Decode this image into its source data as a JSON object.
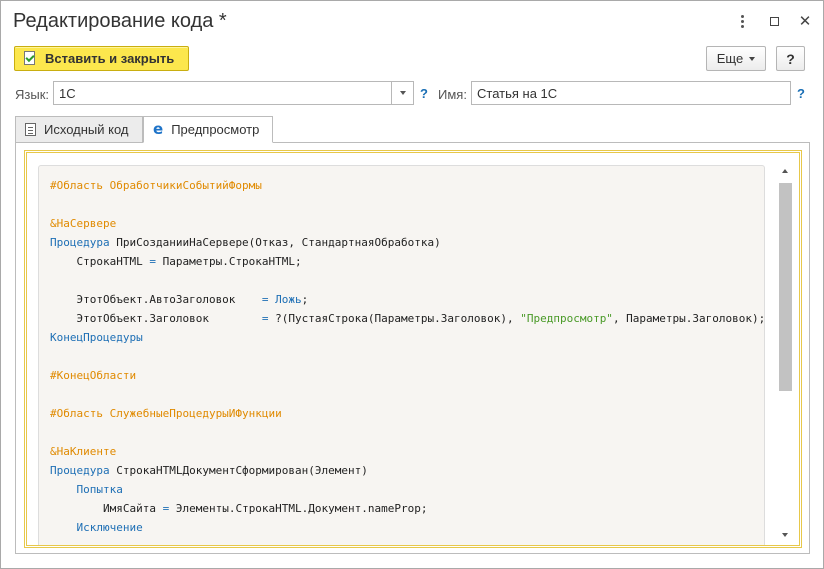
{
  "window": {
    "title": "Редактирование кода *"
  },
  "toolbar": {
    "insert_close_label": "Вставить и закрыть",
    "more_label": "Еще",
    "help_label": "?"
  },
  "form": {
    "language_label": "Язык:",
    "language_value": "1С",
    "language_help": "?",
    "name_label": "Имя:",
    "name_value": "Статья на 1С",
    "name_help": "?"
  },
  "tabs": [
    {
      "label": "Исходный код",
      "active": false,
      "icon": "source-code-icon"
    },
    {
      "label": "Предпросмотр",
      "active": true,
      "icon": "edge-browser-icon"
    }
  ],
  "colors": {
    "primary_button": "#fce74d",
    "frame_border": "#e7c84a",
    "keyword": "#1e6fb5",
    "directive": "#e08a00",
    "string": "#4a9a28"
  },
  "code_lines": [
    [
      [
        "dir",
        "#Область ОбработчикиСобытийФормы"
      ]
    ],
    [],
    [
      [
        "dir",
        "&НаСервере"
      ]
    ],
    [
      [
        "kw",
        "Процедура"
      ],
      [
        "plain",
        " ПриСозданииНаСервере(Отказ, СтандартнаяОбработка)"
      ]
    ],
    [
      [
        "plain",
        "    СтрокаHTML "
      ],
      [
        "op",
        "="
      ],
      [
        "plain",
        " Параметры.СтрокаHTML;"
      ]
    ],
    [],
    [
      [
        "plain",
        "    ЭтотОбъект.АвтоЗаголовок    "
      ],
      [
        "op",
        "="
      ],
      [
        "plain",
        " "
      ],
      [
        "kw",
        "Ложь"
      ],
      [
        "plain",
        ";"
      ]
    ],
    [
      [
        "plain",
        "    ЭтотОбъект.Заголовок        "
      ],
      [
        "op",
        "="
      ],
      [
        "plain",
        " ?(ПустаяСтрока(Параметры.Заголовок), "
      ],
      [
        "str",
        "\"Предпросмотр\""
      ],
      [
        "plain",
        ", Параметры.Заголовок);"
      ]
    ],
    [
      [
        "kw",
        "КонецПроцедуры"
      ]
    ],
    [],
    [
      [
        "dir",
        "#КонецОбласти"
      ]
    ],
    [],
    [
      [
        "dir",
        "#Область СлужебныеПроцедурыИФункции"
      ]
    ],
    [],
    [
      [
        "dir",
        "&НаКлиенте"
      ]
    ],
    [
      [
        "kw",
        "Процедура"
      ],
      [
        "plain",
        " СтрокаHTMLДокументСформирован(Элемент)"
      ]
    ],
    [
      [
        "plain",
        "    "
      ],
      [
        "kw",
        "Попытка"
      ]
    ],
    [
      [
        "plain",
        "        ИмяСайта "
      ],
      [
        "op",
        "="
      ],
      [
        "plain",
        " Элементы.СтрокаHTML.Документ.nameProp;"
      ]
    ],
    [
      [
        "plain",
        "    "
      ],
      [
        "kw",
        "Исключение"
      ]
    ]
  ]
}
